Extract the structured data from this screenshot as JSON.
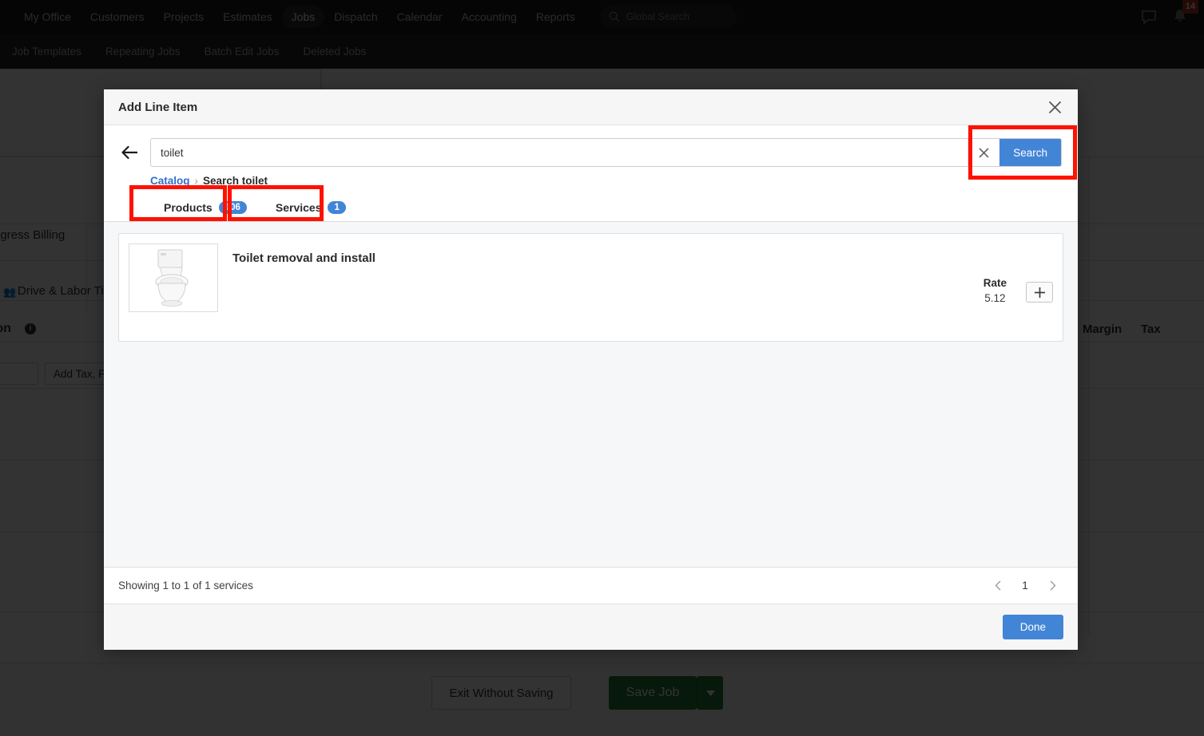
{
  "topnav": {
    "items": [
      {
        "label": "My Office",
        "active": false
      },
      {
        "label": "Customers",
        "active": false
      },
      {
        "label": "Projects",
        "active": false
      },
      {
        "label": "Estimates",
        "active": false
      },
      {
        "label": "Jobs",
        "active": true
      },
      {
        "label": "Dispatch",
        "active": false
      },
      {
        "label": "Calendar",
        "active": false
      },
      {
        "label": "Accounting",
        "active": false
      },
      {
        "label": "Reports",
        "active": false
      }
    ],
    "global_search_placeholder": "Global Search",
    "chat_icon": "chat-bubble-icon",
    "bell_icon": "bell-icon",
    "notification_count": "14"
  },
  "subnav": {
    "items": [
      {
        "label": "Job Templates"
      },
      {
        "label": "Repeating Jobs"
      },
      {
        "label": "Batch Edit Jobs"
      },
      {
        "label": "Deleted Jobs"
      }
    ]
  },
  "background": {
    "progress_billing_label": "ogress Billing",
    "drive_labor_label": "Drive & Labor Tim",
    "section_label": "ion",
    "info_icon": "info-icon",
    "add_tax_button": "Add Tax, Fe",
    "margin_header": "Margin",
    "tax_header": "Tax",
    "exit_button": "Exit Without Saving",
    "save_button": "Save Job",
    "save_caret": "caret-down-icon"
  },
  "modal": {
    "title": "Add Line Item",
    "close_icon": "close-icon",
    "back_icon": "back-arrow-icon",
    "search": {
      "value": "toilet",
      "placeholder": "",
      "clear_icon": "clear-x-icon",
      "search_button": "Search"
    },
    "breadcrumb": {
      "root": "Catalog",
      "separator": "›",
      "current": "Search toilet"
    },
    "tabs": [
      {
        "label": "Products",
        "count": "106",
        "active": false
      },
      {
        "label": "Services",
        "count": "1",
        "active": true
      }
    ],
    "results": [
      {
        "title": "Toilet removal and install",
        "thumbnail": "toilet-product-image",
        "rate_label": "Rate",
        "rate_value": "5.12",
        "add_icon": "plus-icon"
      }
    ],
    "footer": {
      "showing_text": "Showing 1 to 1 of 1 services",
      "prev_icon": "chevron-left-icon",
      "page": "1",
      "next_icon": "chevron-right-icon",
      "done_button": "Done"
    }
  },
  "annotations": {
    "highlight_color": "#ff1100",
    "boxes": [
      {
        "name": "search-controls-highlight"
      },
      {
        "name": "products-tab-highlight"
      },
      {
        "name": "services-tab-highlight"
      }
    ]
  }
}
